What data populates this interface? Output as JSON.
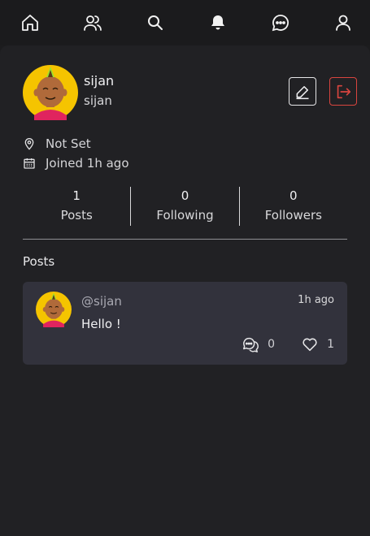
{
  "nav": {
    "items": [
      {
        "icon": "home-icon",
        "active": false
      },
      {
        "icon": "users-icon",
        "active": false
      },
      {
        "icon": "search-icon",
        "active": false
      },
      {
        "icon": "bell-icon",
        "active": true
      },
      {
        "icon": "chat-icon",
        "active": false
      },
      {
        "icon": "user-icon",
        "active": false
      }
    ]
  },
  "profile": {
    "name": "sijan",
    "username": "sijan",
    "location": "Not Set",
    "joined": "Joined 1h ago"
  },
  "stats": [
    {
      "value": "1",
      "label": "Posts"
    },
    {
      "value": "0",
      "label": "Following"
    },
    {
      "value": "0",
      "label": "Followers"
    }
  ],
  "posts_section": {
    "title": "Posts"
  },
  "post": {
    "handle": "@sijan",
    "time": "1h ago",
    "body": "Hello !",
    "comments": "0",
    "likes": "1"
  },
  "colors": {
    "background": "#1c1c1e",
    "panel": "#212124",
    "card": "#32323c",
    "logout_accent": "#d9453f",
    "avatar_bg": "#f5c400"
  }
}
